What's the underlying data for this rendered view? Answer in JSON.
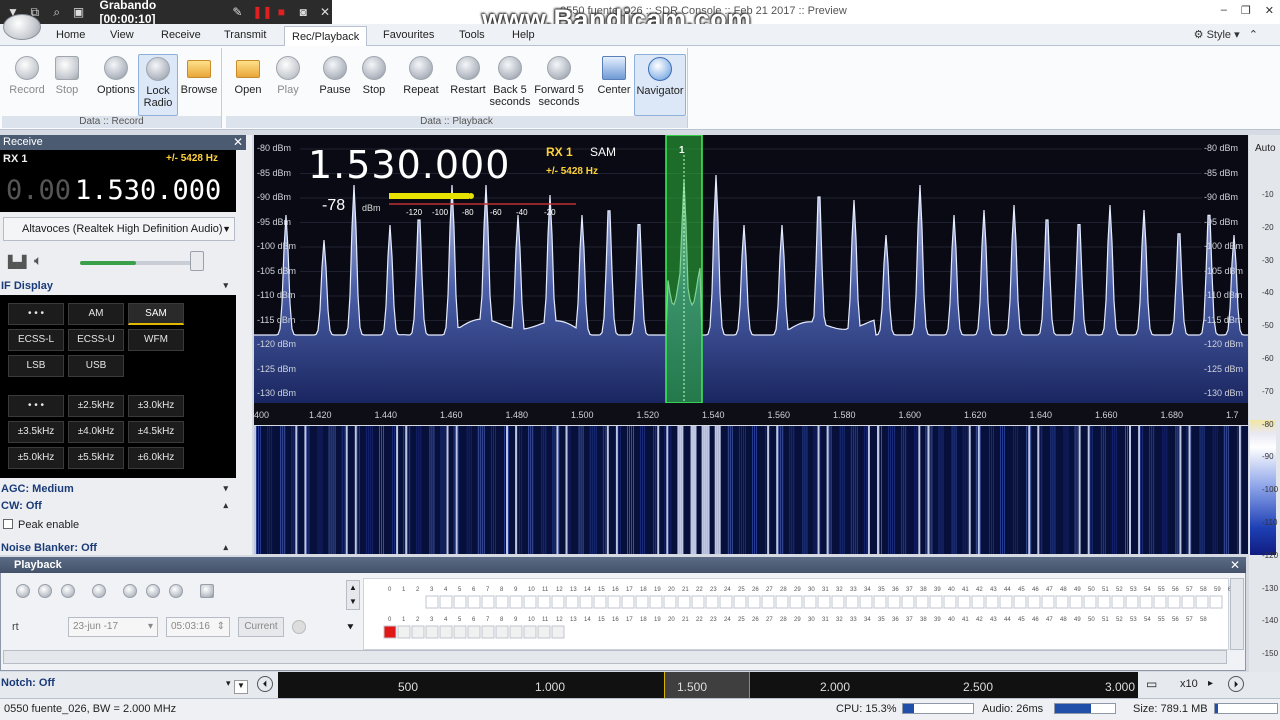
{
  "recorder": {
    "status": "Grabando [00:00:10]"
  },
  "window": {
    "title": "0550 fuente_026 :: SDR Console :: Feb 21 2017 :: Preview",
    "watermark": "www.Bandicam.com"
  },
  "menu": {
    "tabs": [
      "Home",
      "View",
      "Receive",
      "Transmit",
      "Rec/Playback",
      "Favourites",
      "Tools",
      "Help"
    ],
    "active": "Rec/Playback",
    "style_label": "Style"
  },
  "ribbon": {
    "record_group": {
      "label": "Data :: Record",
      "buttons": [
        "Record",
        "Stop",
        "Options",
        "Lock Radio",
        "Browse"
      ]
    },
    "playback_group": {
      "label": "Data :: Playback",
      "buttons": [
        "Open",
        "Play",
        "Pause",
        "Stop",
        "Repeat",
        "Restart",
        "Back 5 seconds",
        "Forward 5 seconds",
        "Center",
        "Navigator"
      ]
    }
  },
  "receive_panel": {
    "header": "Receive",
    "rx": "RX 1",
    "offset": "+/- 5428 Hz",
    "freq_prefix": "0.00",
    "freq_main": "1.530.000",
    "audio_device": "Altavoces (Realtek High Definition Audio)",
    "volume": 0.48,
    "if_display": "IF Display",
    "modes": [
      "• • •",
      "AM",
      "SAM",
      "ECSS-L",
      "ECSS-U",
      "WFM",
      "LSB",
      "USB"
    ],
    "active_mode": "SAM",
    "bandwidths": [
      "• • •",
      "±2.5kHz",
      "±3.0kHz",
      "±3.5kHz",
      "±4.0kHz",
      "±4.5kHz",
      "±5.0kHz",
      "±5.5kHz",
      "±6.0kHz"
    ],
    "agc": "AGC: Medium",
    "cw": "CW: Off",
    "peak": "Peak enable",
    "noise_blanker": "Noise Blanker: Off",
    "notch": "Notch: Off"
  },
  "spectrum": {
    "big_freq": "1.530.000",
    "rx": "RX 1",
    "mode": "SAM",
    "offset": "+/- 5428 Hz",
    "signal_dbm": "-78",
    "signal_unit": "dBm",
    "smeter_ticks": [
      "-120",
      "-100",
      "-80",
      "-60",
      "-40",
      "-20"
    ],
    "marker": "1",
    "y_labels": [
      "-80 dBm",
      "-85 dBm",
      "-90 dBm",
      "-95 dBm",
      "-100 dBm",
      "-105 dBm",
      "-110 dBm",
      "-115 dBm",
      "-120 dBm",
      "-125 dBm",
      "-130 dBm"
    ],
    "x_labels": [
      "400",
      "1.420",
      "1.440",
      "1.460",
      "1.480",
      "1.500",
      "1.520",
      "1.540",
      "1.560",
      "1.580",
      "1.600",
      "1.620",
      "1.640",
      "1.660",
      "1.680",
      "1.7"
    ]
  },
  "right_panel": {
    "auto": "Auto",
    "scale": [
      "-10",
      "-20",
      "-30",
      "-40",
      "-50",
      "-60",
      "-70",
      "-80",
      "-90",
      "-100",
      "-110",
      "-120",
      "-130",
      "-140",
      "-150"
    ]
  },
  "playback": {
    "header": "Playback",
    "date": "23-jun -17",
    "time": "05:03:16",
    "current": "Current",
    "rt": "rt"
  },
  "bottom_scale": {
    "labels": [
      "500",
      "1.000",
      "1.500",
      "2.000",
      "2.500",
      "3.000"
    ],
    "zoom": "x10"
  },
  "status": {
    "file": "0550 fuente_026, BW = 2.000 MHz",
    "cpu": "CPU: 15.3%",
    "cpu_level": 0.15,
    "audio": "Audio: 26ms",
    "audio_level": 0.6,
    "size": "Size: 789.1 MB"
  }
}
